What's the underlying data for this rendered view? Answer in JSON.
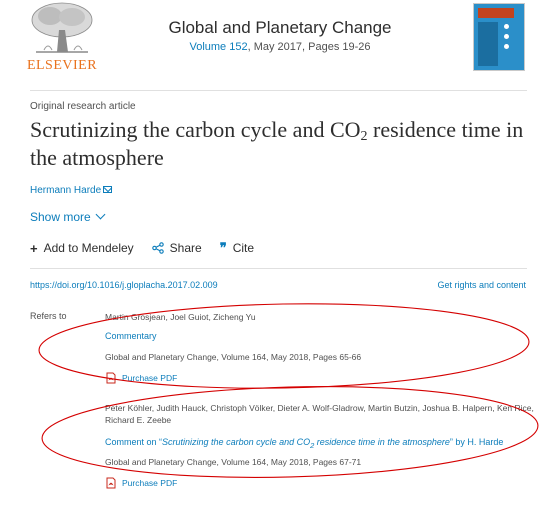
{
  "header": {
    "publisher_logo_text": "ELSEVIER",
    "journal_title": "Global and Planetary Change",
    "volume_link": "Volume 152",
    "volume_rest": ", May 2017, Pages 19-26"
  },
  "article": {
    "type": "Original research article",
    "title_part1": "Scrutinizing the carbon cycle and CO",
    "title_sub": "2",
    "title_part2": " residence time in the atmosphere",
    "author": "Hermann Harde",
    "show_more": "Show more"
  },
  "actions": {
    "add_mendeley": "Add to Mendeley",
    "share": "Share",
    "cite": "Cite"
  },
  "links": {
    "doi": "https://doi.org/10.1016/j.gloplacha.2017.02.009",
    "rights": "Get rights and content"
  },
  "refers": {
    "label": "Refers to",
    "items": [
      {
        "authors": "Martin Grosjean, Joel Guiot, Zicheng Yu",
        "comment": "Commentary",
        "source": "Global and Planetary Change, Volume 164, May 2018, Pages 65-66",
        "pdf": "Purchase PDF"
      },
      {
        "authors": "Peter Köhler, Judith Hauck, Christoph Völker, Dieter A. Wolf-Gladrow, Martin Butzin, Joshua B. Halpern, Ken Rice, Richard E. Zeebe",
        "comment_prefix": "Comment on “",
        "comment_title_part1": "Scrutinizing the carbon cycle and CO",
        "comment_title_sub": "2",
        "comment_title_part2": " residence time in the atmosphere",
        "comment_suffix": "” by H. Harde",
        "source": "Global and Planetary Change, Volume 164, May 2018, Pages 67-71",
        "pdf": "Purchase PDF"
      }
    ]
  },
  "colors": {
    "link": "#0c7dbb",
    "annotation": "#d40000",
    "elsevier_orange": "#e9711c"
  }
}
